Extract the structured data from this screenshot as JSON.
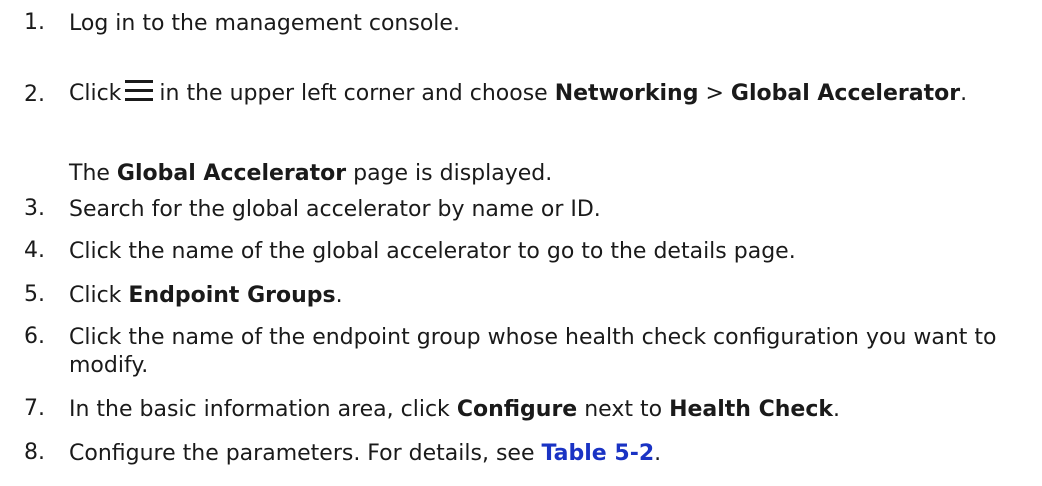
{
  "steps": [
    {
      "num": "1.",
      "text": "Log in to the management console."
    },
    {
      "num": "2.",
      "pre": "Click",
      "post": "in the upper left corner and choose",
      "b1": "Networking",
      "sep": ">",
      "b2": "Global Accelerator",
      "end": ".",
      "icon": "menu-icon",
      "sub_b": "Global Accelerator",
      "sub_rest": "page is displayed.",
      "sub_pre": "The"
    },
    {
      "num": "3.",
      "text": "Search for the global accelerator by name or ID."
    },
    {
      "num": "4.",
      "text": "Click the name of the global accelerator to go to the details page."
    },
    {
      "num": "5.",
      "pre": "Click",
      "b1": "Endpoint Groups",
      "end": "."
    },
    {
      "num": "6.",
      "text": "Click the name of the endpoint group whose health check configuration you want to modify."
    },
    {
      "num": "7.",
      "pre": "In the basic information area, click",
      "b1": "Configure",
      "mid": "next to",
      "b2": "Health Check",
      "end": "."
    },
    {
      "num": "8.",
      "pre": "Configure the parameters. For details, see",
      "link": "Table 5-2",
      "end": "."
    }
  ],
  "colors": {
    "text": "#1a1a1a",
    "link": "#1a33c4"
  }
}
